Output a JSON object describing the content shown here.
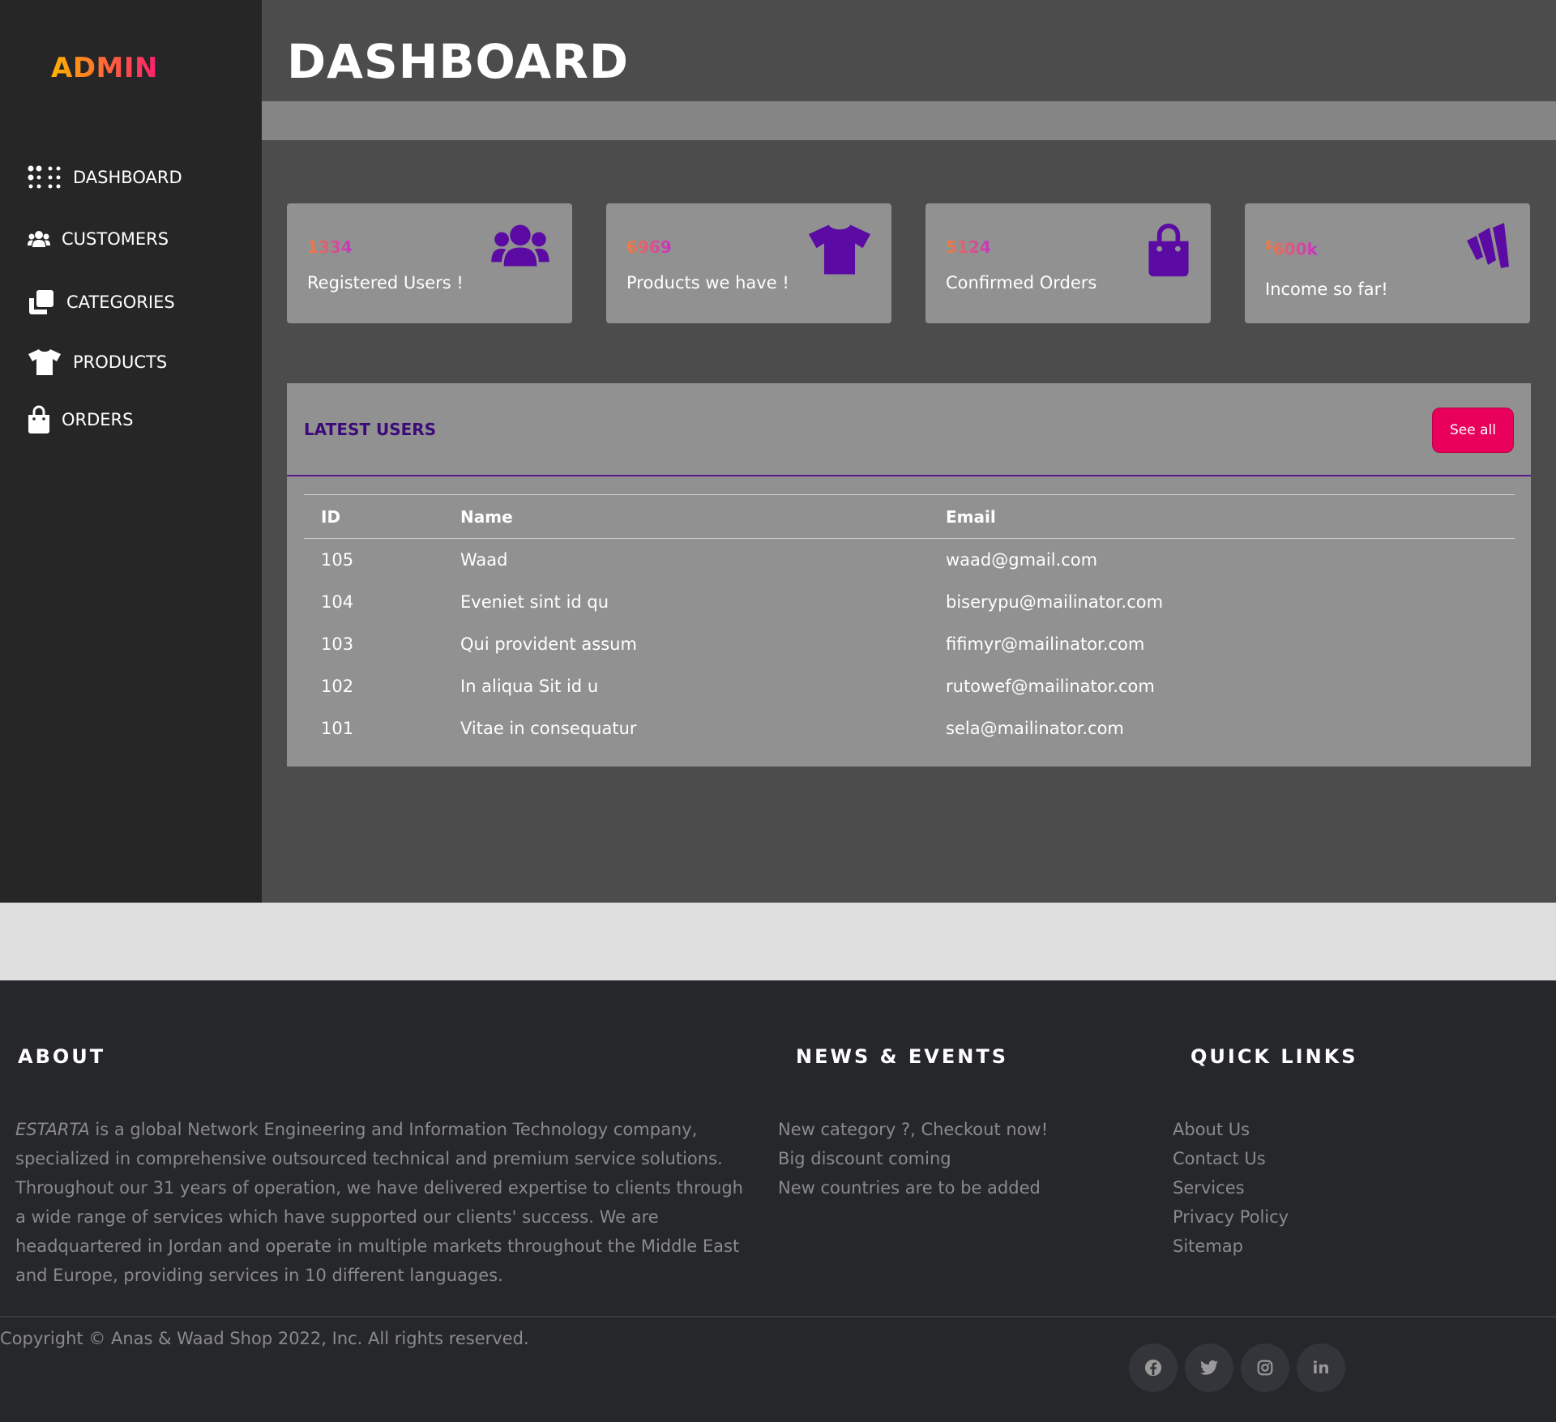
{
  "brand": "ADMIN",
  "sidebar": {
    "items": [
      {
        "label": "DASHBOARD",
        "icon": "dashboard-icon"
      },
      {
        "label": "CUSTOMERS",
        "icon": "users-icon"
      },
      {
        "label": "CATEGORIES",
        "icon": "copy-icon"
      },
      {
        "label": "PRODUCTS",
        "icon": "tshirt-icon"
      },
      {
        "label": "ORDERS",
        "icon": "shopping-bag-icon"
      }
    ]
  },
  "header": {
    "title": "DASHBOARD"
  },
  "cards": [
    {
      "value": "1334",
      "label": "Registered Users !",
      "icon": "users-icon"
    },
    {
      "value": "6969",
      "label": "Products we have !",
      "icon": "tshirt-icon"
    },
    {
      "value": "5124",
      "label": "Confirmed Orders",
      "icon": "shopping-bag-icon"
    },
    {
      "value_prefix": "$",
      "value": "600k",
      "label": "Income so far!",
      "icon": "wave-logo-icon"
    }
  ],
  "latest_users": {
    "title": "LATEST USERS",
    "button": "See all",
    "columns": [
      "ID",
      "Name",
      "Email"
    ],
    "rows": [
      [
        "105",
        "Waad",
        "waad@gmail.com"
      ],
      [
        "104",
        "Eveniet sint id qu",
        "biserypu@mailinator.com"
      ],
      [
        "103",
        "Qui provident assum",
        "fifimyr@mailinator.com"
      ],
      [
        "102",
        "In aliqua Sit id u",
        "rutowef@mailinator.com"
      ],
      [
        "101",
        "Vitae in consequatur",
        "sela@mailinator.com"
      ]
    ]
  },
  "footer": {
    "about": {
      "heading": "ABOUT",
      "company": "ESTARTA",
      "text": " is a global Network Engineering and Information Technology company, specialized in comprehensive outsourced technical and premium service solutions. Throughout our 31 years of operation, we have delivered expertise to clients through a wide range of services which have supported our clients' success. We are headquartered in Jordan and operate in multiple markets throughout the Middle East and Europe, providing services in 10 different languages."
    },
    "news": {
      "heading": "NEWS & EVENTS",
      "items": [
        "New category ?, Checkout now!",
        "Big discount coming",
        "New countries are to be added"
      ]
    },
    "quick_links": {
      "heading": "QUICK LINKS",
      "items": [
        "About Us",
        "Contact Us",
        "Services",
        "Privacy Policy",
        "Sitemap"
      ]
    },
    "copyright": "Copyright © Anas & Waad Shop 2022, Inc. All rights reserved.",
    "social": [
      "facebook-icon",
      "twitter-icon",
      "instagram-icon",
      "linkedin-icon"
    ],
    "linkedin_text": "in"
  },
  "colors": {
    "sidebar_bg": "#262626",
    "main_bg": "#4c4c4c",
    "card_bg": "#919191",
    "icon_accent": "#5b0aa3",
    "button_accent": "#e8005a",
    "footer_bg": "#25272b"
  }
}
